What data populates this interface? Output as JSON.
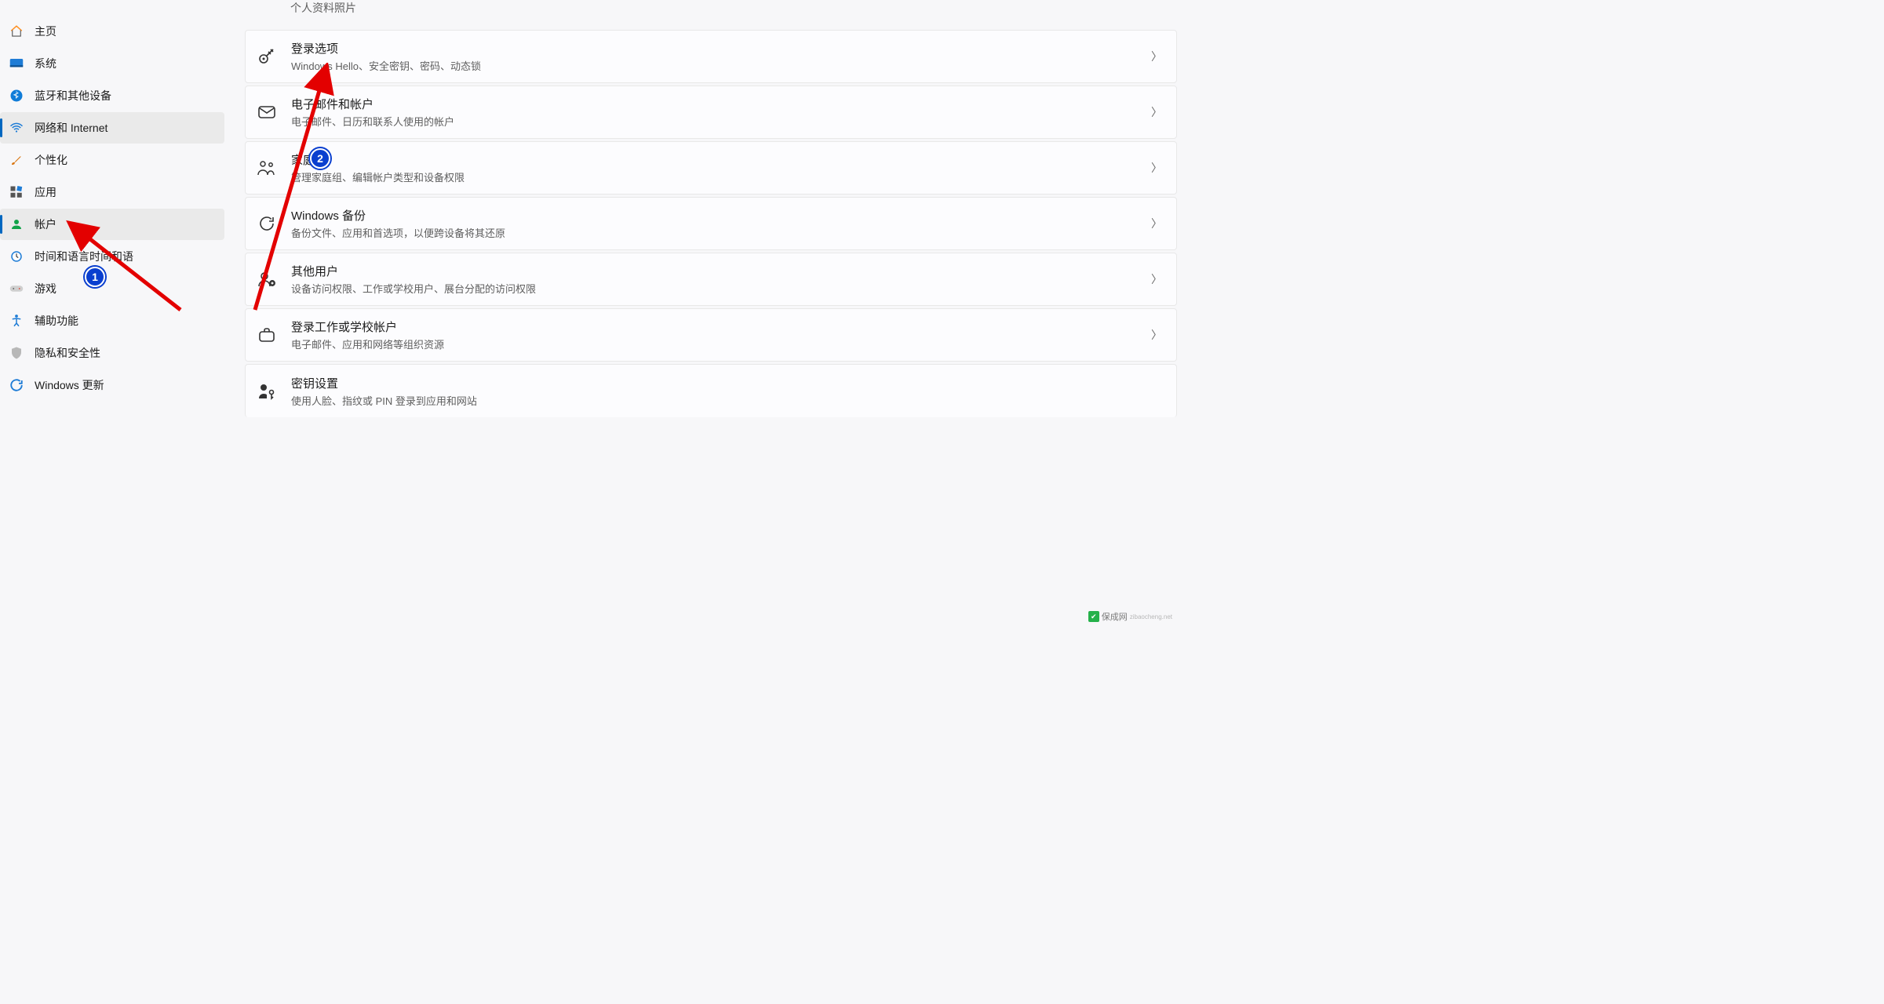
{
  "sidebar": {
    "items": [
      {
        "label": "主页",
        "icon": "home"
      },
      {
        "label": "系统",
        "icon": "system"
      },
      {
        "label": "蓝牙和其他设备",
        "icon": "bluetooth"
      },
      {
        "label": "网络和 Internet",
        "icon": "wifi",
        "selected": true
      },
      {
        "label": "个性化",
        "icon": "brush"
      },
      {
        "label": "应用",
        "icon": "apps"
      },
      {
        "label": "帐户",
        "icon": "account",
        "selected": true
      },
      {
        "label": "时间和语言时间和语",
        "icon": "clock"
      },
      {
        "label": "游戏",
        "icon": "gamepad"
      },
      {
        "label": "辅助功能",
        "icon": "accessibility"
      },
      {
        "label": "隐私和安全性",
        "icon": "shield"
      },
      {
        "label": "Windows 更新",
        "icon": "update"
      }
    ]
  },
  "main": {
    "partial_top": "个人资料照片",
    "cards": [
      {
        "title": "登录选项",
        "sub": "Windows Hello、安全密钥、密码、动态锁",
        "icon": "key"
      },
      {
        "title": "电子邮件和帐户",
        "sub": "电子邮件、日历和联系人使用的帐户",
        "icon": "mail"
      },
      {
        "title": "家庭",
        "sub": "管理家庭组、编辑帐户类型和设备权限",
        "icon": "family"
      },
      {
        "title": "Windows 备份",
        "sub": "备份文件、应用和首选项，以便跨设备将其还原",
        "icon": "backup"
      },
      {
        "title": "其他用户",
        "sub": "设备访问权限、工作或学校用户、展台分配的访问权限",
        "icon": "otherusers"
      },
      {
        "title": "登录工作或学校帐户",
        "sub": "电子邮件、应用和网络等组织资源",
        "icon": "briefcase"
      },
      {
        "title": "密钥设置",
        "sub": "使用人脸、指纹或 PIN 登录到应用和网站",
        "icon": "passkey"
      }
    ]
  },
  "annotations": {
    "badge1": "1",
    "badge2": "2"
  },
  "watermark": {
    "text": "保成网",
    "sub": "zibaocheng.net"
  }
}
